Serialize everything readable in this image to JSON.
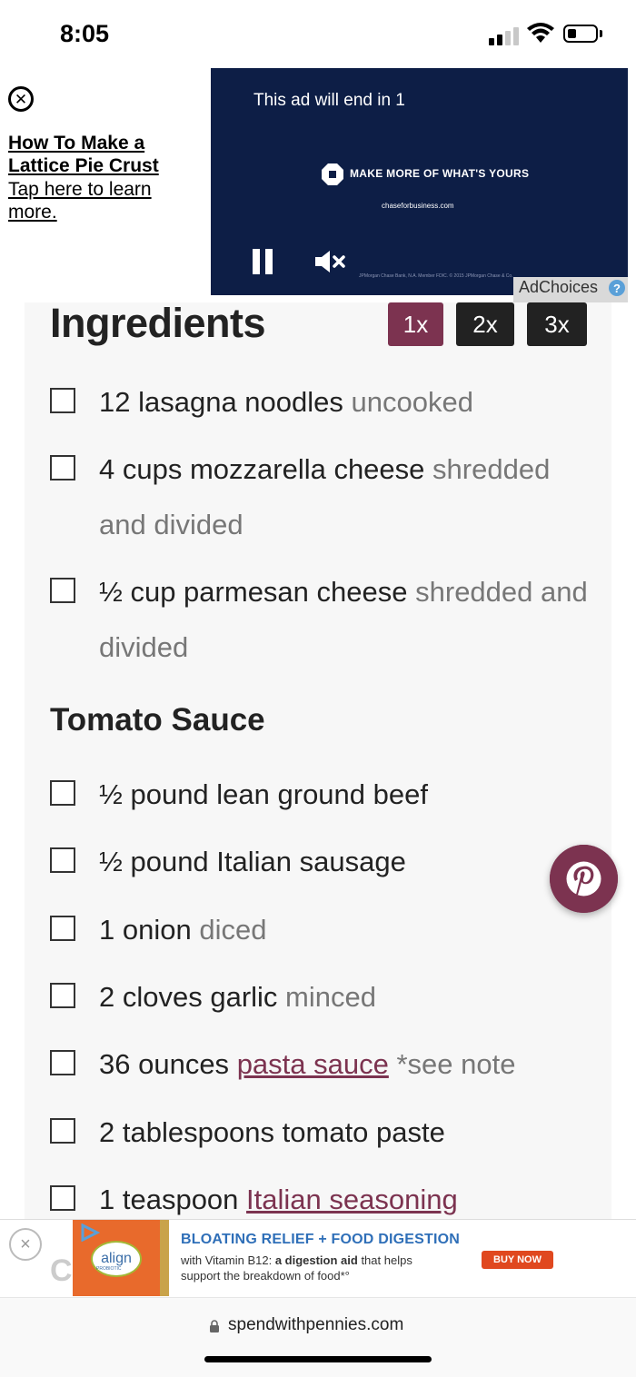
{
  "status_bar": {
    "time": "8:05"
  },
  "top_ad": {
    "headline": "How To Make a Lattice Pie Crust",
    "subtext": "Tap here to learn more.",
    "video": {
      "countdown": "This ad will end in 1",
      "tagline": "MAKE MORE OF WHAT'S YOURS",
      "url": "chaseforbusiness.com",
      "fineprint": "JPMorgan Chase Bank, N.A. Member FDIC. © 2015 JPMorgan Chase & Co."
    },
    "adchoices_label": "AdChoices"
  },
  "recipe": {
    "ingredients_title": "Ingredients",
    "scale_options": [
      "1x",
      "2x",
      "3x"
    ],
    "selected_scale": "1x",
    "ingredients": [
      {
        "main": "12 lasagna noodles",
        "note": "uncooked"
      },
      {
        "main": "4 cups mozzarella cheese",
        "note": "shredded and divided"
      },
      {
        "main": "½ cup parmesan cheese",
        "note": "shredded and divided"
      }
    ],
    "tomato_sauce_heading": "Tomato Sauce",
    "tomato_sauce": [
      {
        "main": "½ pound lean ground beef",
        "note": ""
      },
      {
        "main": "½ pound Italian sausage",
        "note": ""
      },
      {
        "main": "1 onion",
        "note": "diced"
      },
      {
        "main": "2 cloves garlic",
        "note": "minced"
      },
      {
        "main": "36 ounces",
        "link": "pasta sauce",
        "note": "*see note"
      },
      {
        "main": "2 tablespoons tomato paste",
        "note": ""
      },
      {
        "main": "1 teaspoon",
        "link": "Italian seasoning",
        "note": ""
      }
    ],
    "next_section_peek": "C"
  },
  "bottom_ad": {
    "brand": "align",
    "brand_sub": "PROBIOTIC",
    "headline": "BLOATING RELIEF + FOOD DIGESTION",
    "copy_prefix": "with Vitamin B12: ",
    "copy_bold": "a digestion aid",
    "copy_suffix": " that helps support the breakdown of food*°",
    "cta": "BUY NOW",
    "close": "×"
  },
  "browser": {
    "url": "spendwithpennies.com"
  },
  "colors": {
    "accent": "#7c3350",
    "dark_button": "#222222",
    "video_bg": "#0d1e46"
  }
}
